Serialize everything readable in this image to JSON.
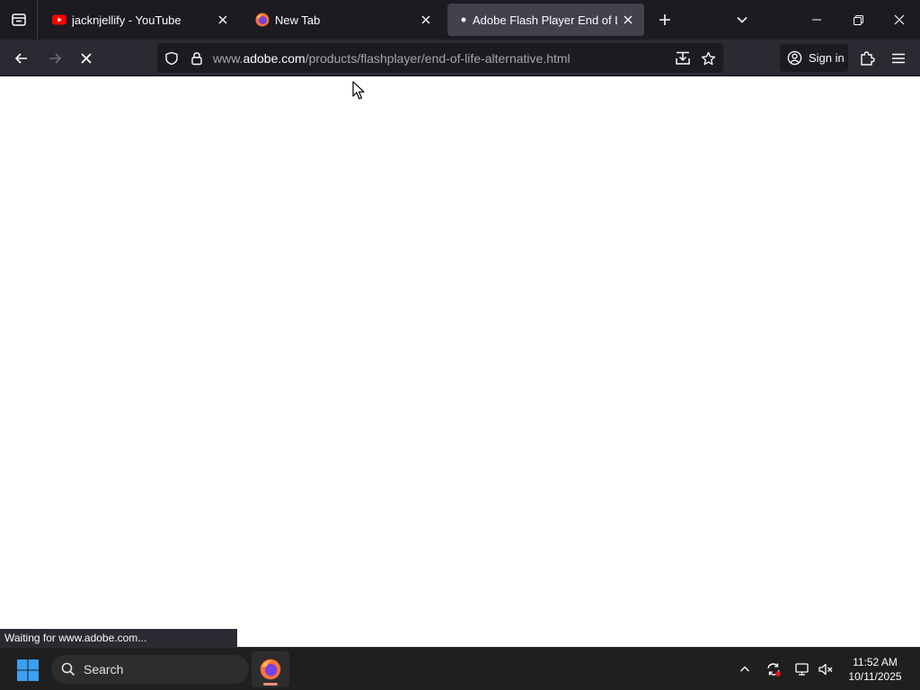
{
  "colors": {
    "tabstrip_bg": "#1c1b22",
    "navbar_bg": "#2b2a33",
    "active_tab_bg": "#42414d",
    "urlbar_bg": "#1c1b22",
    "text_light": "#fbfbfe",
    "text_muted": "#a6a5ad",
    "taskbar_bg": "#1f1f1f",
    "youtube_red": "#ff0000",
    "windows_blue": "#3aa0f3"
  },
  "tabs": [
    {
      "title": "jacknjellify - YouTube",
      "icon": "youtube-icon",
      "active": false
    },
    {
      "title": "New Tab",
      "icon": "firefox-icon",
      "active": false
    },
    {
      "title": "Adobe Flash Player End of Life",
      "icon": "loading-dot-icon",
      "active": true
    }
  ],
  "urlbar": {
    "prefix": "www.",
    "domain": "adobe.com",
    "path": "/products/flashplayer/end-of-life-alternative.html"
  },
  "toolbar": {
    "sign_in_label": "Sign in"
  },
  "status": {
    "text": "Waiting for www.adobe.com..."
  },
  "taskbar": {
    "search_placeholder": "Search",
    "time": "11:52 AM",
    "date": "10/11/2025"
  }
}
